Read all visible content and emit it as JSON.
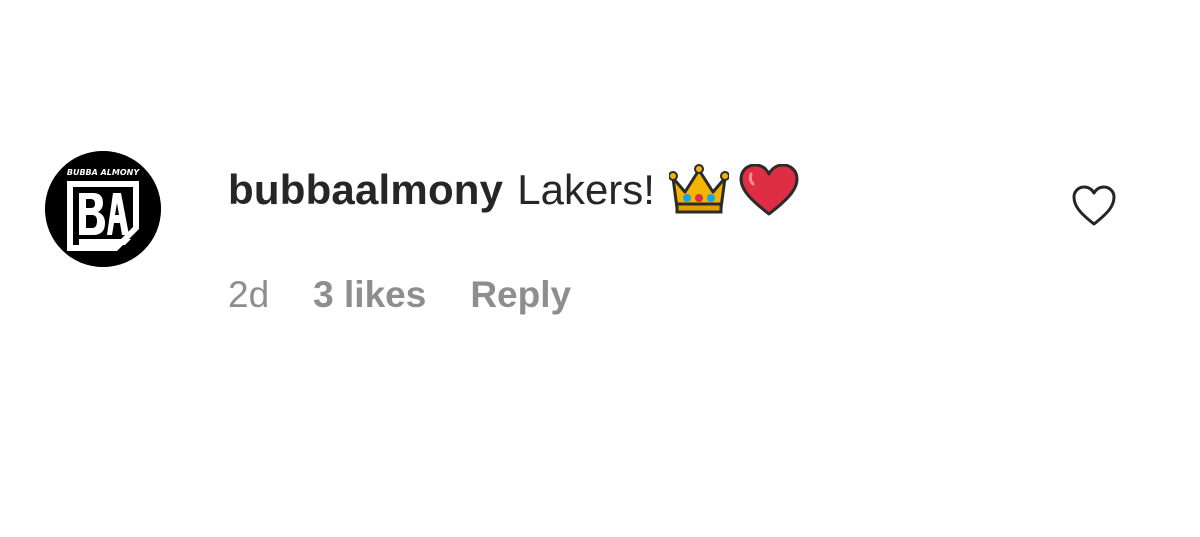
{
  "comment": {
    "username": "bubbaalmony",
    "text": "Lakers!",
    "emojis": [
      {
        "name": "crown-emoji",
        "glyph": "👑"
      },
      {
        "name": "red-heart-emoji",
        "glyph": "❤️"
      }
    ],
    "timestamp": "2d",
    "likes": "3 likes",
    "reply_label": "Reply",
    "like_icon": "heart-outline-icon"
  },
  "avatar": {
    "logo_text": "BUBBA ALMONY",
    "monogram": "BA",
    "colors": {
      "background": "#000000",
      "foreground": "#ffffff"
    }
  },
  "colors": {
    "primary_text": "#262626",
    "secondary_text": "#8e8e8e",
    "background": "#ffffff",
    "heart_emoji": "#dd2e44",
    "crown_emoji": "#f4b400"
  }
}
